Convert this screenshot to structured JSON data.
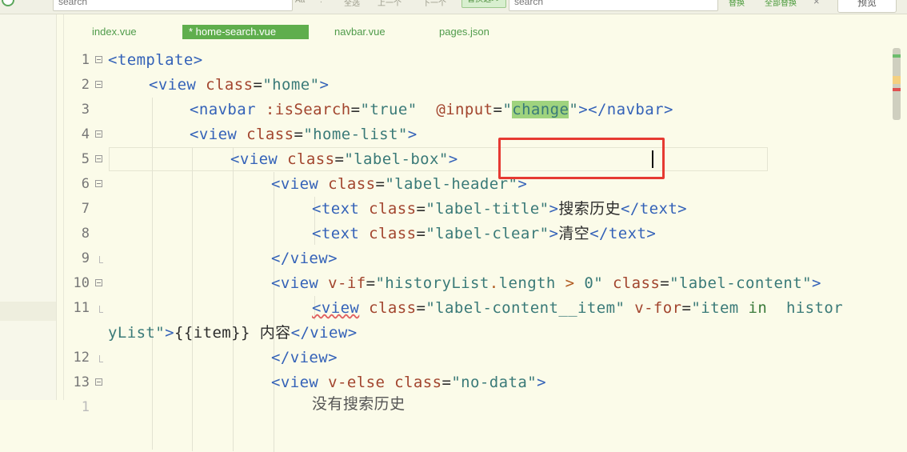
{
  "findbar": {
    "search_value": "search",
    "option_match_case": "Aa",
    "option_regex": ".*",
    "option_whole_word": "全选",
    "option_prev": "上一个",
    "option_next": "下一个",
    "mode_label": "替换选>>",
    "replace_value": "search",
    "replace_label": "替换",
    "replace_all_label": "全部替换",
    "close_label": "×",
    "preview_label": "预览"
  },
  "tabs": [
    {
      "label": "index.vue"
    },
    {
      "label": "* home-search.vue"
    },
    {
      "label": "navbar.vue"
    },
    {
      "label": "pages.json"
    }
  ],
  "lines": [
    {
      "num": "1"
    },
    {
      "num": "2"
    },
    {
      "num": "3"
    },
    {
      "num": "4"
    },
    {
      "num": "5"
    },
    {
      "num": "6"
    },
    {
      "num": "7",
      "text": "搜索历史"
    },
    {
      "num": "8",
      "text": "清空"
    },
    {
      "num": "9"
    },
    {
      "num": "10"
    },
    {
      "num": "11",
      "text": "内容"
    },
    {
      "num": "12"
    },
    {
      "num": "13"
    }
  ],
  "partial_line_text": "没有搜索历史",
  "colors": {
    "editor_bg": "#fbfbe9",
    "tag": "#3462b8",
    "attr": "#a2452e",
    "string": "#3a7a78",
    "highlight": "#e63a32",
    "accent": "#5fae4d"
  }
}
